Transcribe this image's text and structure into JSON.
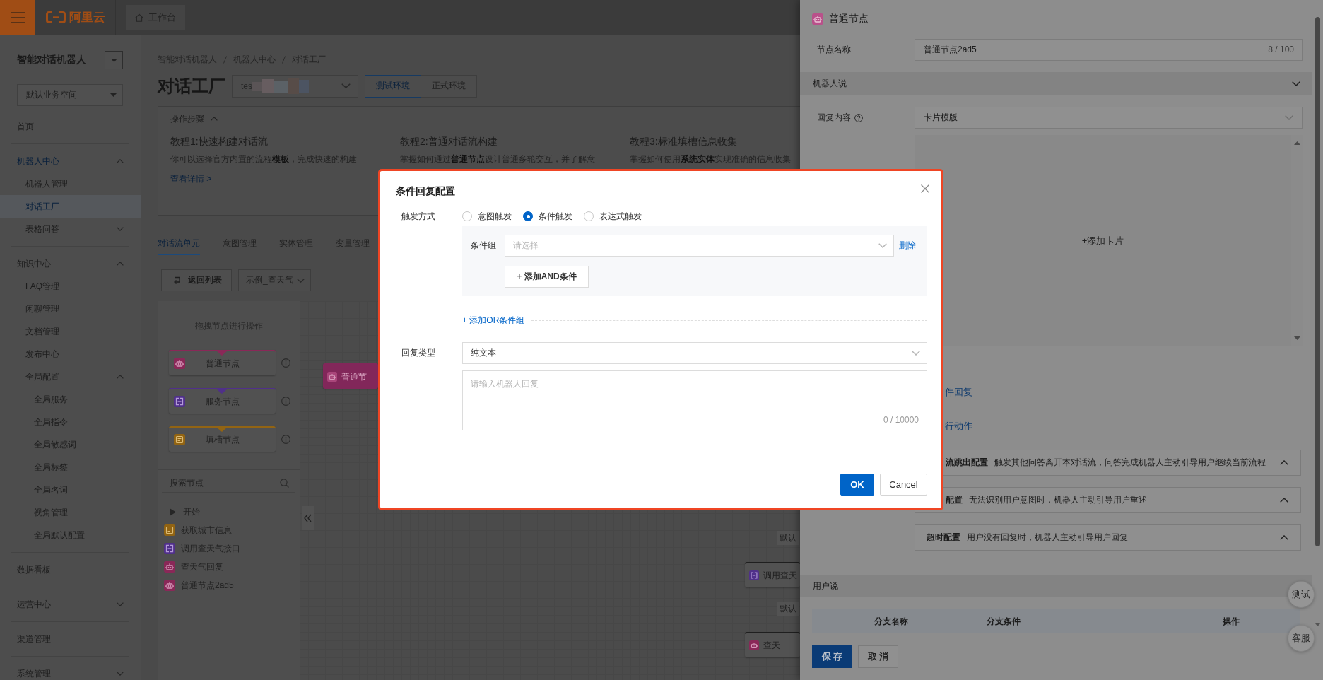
{
  "header": {
    "logo": "阿里云",
    "workbench_tab": "工作台"
  },
  "sidebar": {
    "title": "智能对话机器人",
    "workspace": "默认业务空间",
    "items": [
      {
        "label": "首页",
        "selected": false
      },
      {
        "label": "机器人中心",
        "selected": false,
        "expanded": true,
        "children": [
          {
            "label": "机器人管理",
            "selected": false
          },
          {
            "label": "对话工厂",
            "selected": true
          },
          {
            "label": "表格问答",
            "selected": false,
            "expanded": false
          }
        ]
      },
      {
        "label": "知识中心",
        "selected": false,
        "expanded": true,
        "children": [
          {
            "label": "FAQ管理",
            "selected": false
          },
          {
            "label": "闲聊管理",
            "selected": false
          },
          {
            "label": "文档管理",
            "selected": false
          },
          {
            "label": "发布中心",
            "selected": false
          },
          {
            "label": "全局配置",
            "selected": false,
            "expanded": true,
            "children": [
              {
                "label": "全局服务",
                "selected": false
              },
              {
                "label": "全局指令",
                "selected": false
              },
              {
                "label": "全局敏感词",
                "selected": false
              },
              {
                "label": "全局标签",
                "selected": false
              },
              {
                "label": "全局名词",
                "selected": false
              },
              {
                "label": "视角管理",
                "selected": false
              },
              {
                "label": "全局默认配置",
                "selected": false
              }
            ]
          }
        ]
      },
      {
        "label": "数据看板",
        "selected": false
      },
      {
        "label": "运营中心",
        "selected": false,
        "expanded": false
      },
      {
        "label": "渠道管理",
        "selected": false
      },
      {
        "label": "系统管理",
        "selected": false,
        "expanded": false
      }
    ]
  },
  "main": {
    "breadcrumb": [
      "智能对话机器人",
      "机器人中心",
      "对话工厂"
    ],
    "title": "对话工厂",
    "bot_select": "tes",
    "env_buttons": [
      {
        "label": "测试环境",
        "selected": true
      },
      {
        "label": "正式环境",
        "selected": false
      }
    ],
    "steps": {
      "title": "操作步骤",
      "tutorials": [
        {
          "title": "教程1:快速构建对话流",
          "description": "你可以选择官方内置的流程**模板**，完成快速的构建",
          "link": "查看详情 >"
        },
        {
          "title": "教程2:普通对话流构建",
          "description": "掌握如何通过**普通节点**设计普通多轮交互，并了解意"
        },
        {
          "title": "教程3:标准填槽信息收集",
          "description": "掌握如何使用**系统实体**实现准确的信息收集"
        }
      ]
    },
    "tabs": [
      {
        "label": "对话流单元",
        "selected": true
      },
      {
        "label": "意图管理",
        "selected": false
      },
      {
        "label": "实体管理",
        "selected": false
      },
      {
        "label": "变量管理",
        "selected": false
      }
    ],
    "toolbar": {
      "back_button": "返回列表",
      "flow_select": "示例_查天气"
    },
    "palette": {
      "hint": "拖拽节点进行操作",
      "node_types": [
        {
          "label": "普通节点",
          "kind": "normal"
        },
        {
          "label": "服务节点",
          "kind": "service"
        },
        {
          "label": "填槽节点",
          "kind": "slot"
        }
      ],
      "search": {
        "placeholder": "搜索节点"
      },
      "outline": [
        {
          "label": "开始",
          "kind": "start"
        },
        {
          "label": "获取城市信息",
          "kind": "slot"
        },
        {
          "label": "调用查天气接口",
          "kind": "service"
        },
        {
          "label": "查天气回复",
          "kind": "normal"
        },
        {
          "label": "普通节点2ad5",
          "kind": "normal"
        }
      ]
    },
    "canvas": {
      "nodes": [
        {
          "label": "普通节",
          "kind": "normal",
          "selected": true
        },
        {
          "label": "调用查天",
          "kind": "service",
          "selected": false
        },
        {
          "label": "查天",
          "kind": "normal",
          "selected": false
        }
      ],
      "edge_labels": [
        "默认",
        "默认"
      ]
    }
  },
  "drawer": {
    "title": "普通节点",
    "name_field": {
      "label": "节点名称",
      "value": "普通节点2ad5",
      "counter": "8 / 100"
    },
    "bot_says": {
      "title": "机器人说",
      "reply_label": "回复内容",
      "reply_type": "卡片模版",
      "add_card": "+添加卡片",
      "links": [
        "件回复",
        "行动作"
      ],
      "configs": [
        {
          "title": "流跳出配置",
          "description": "触发其他问答离开本对话流，问答完成机器人主动引导用户继续当前流程"
        },
        {
          "title": "配置",
          "description": "无法识别用户意图时，机器人主动引导用户重述"
        },
        {
          "title": "超时配置",
          "description": "用户没有回复时，机器人主动引导用户回复"
        }
      ]
    },
    "user_says": {
      "title": "用户说",
      "columns": [
        "分支名称",
        "分支条件",
        "操作"
      ]
    },
    "buttons": [
      {
        "label": "保存",
        "kind": "primary"
      },
      {
        "label": "取消",
        "kind": "default"
      }
    ],
    "float_buttons": [
      "测试",
      "客服"
    ]
  },
  "modal": {
    "title": "条件回复配置",
    "trigger": {
      "label": "触发方式",
      "options": [
        {
          "label": "意图触发",
          "selected": false
        },
        {
          "label": "条件触发",
          "selected": true
        },
        {
          "label": "表达式触发",
          "selected": false
        }
      ]
    },
    "condition_group": {
      "label": "条件组",
      "placeholder": "请选择",
      "delete": "删除",
      "add_and": "+ 添加AND条件"
    },
    "add_or": "+ 添加OR条件组",
    "reply_type": {
      "label": "回复类型",
      "value": "纯文本"
    },
    "reply_text": {
      "placeholder": "请输入机器人回复",
      "counter": "0 / 10000"
    },
    "buttons": [
      {
        "label": "OK",
        "kind": "primary"
      },
      {
        "label": "Cancel",
        "kind": "default"
      }
    ]
  }
}
